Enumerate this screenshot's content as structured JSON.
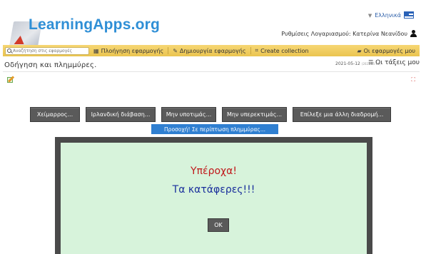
{
  "header": {
    "logo_text": "LearningApps.org",
    "language": "Ελληνικά",
    "account_text": "Ρυθμίσεις Λογαριασμού: Κατερίνα Νεανίδου"
  },
  "navbar": {
    "search_placeholder": "Αναζήτηση στις εφαρμογές",
    "items": [
      {
        "label": "Πλοήγηση εφαρμογής",
        "icon": "grid-icon"
      },
      {
        "label": "Δημιουργία εφαρμογής",
        "icon": "pencil-icon"
      },
      {
        "label": "Create collection",
        "icon": "collection-icon"
      }
    ],
    "my_apps_label": "Οι εφαρμογές μου"
  },
  "page": {
    "title": "Οδήγηση και πλημμύρες.",
    "date": "2021-05-12",
    "date_small": "(2021-05-11)",
    "classes_label": "Οι τάξεις μου"
  },
  "choices": [
    {
      "label": "Χείμαρρος..."
    },
    {
      "label": "Ιρλανδική διάβαση..."
    },
    {
      "label": "Μην υποτιμάς..."
    },
    {
      "label": "Μην υπερεκτιμάς..."
    },
    {
      "label": "Επίλεξε μια άλλη διαδρομή..."
    }
  ],
  "tip": "Προσοχή! Σε περίπτωση πλημμύρας...",
  "modal": {
    "title": "Υπέροχα!",
    "message": "Τα κατάφερες!!!",
    "ok_label": "OK"
  },
  "colors": {
    "navbar": "#eac44f",
    "choice_button": "#5a5a5a",
    "tip": "#2f7fd1",
    "modal_bg": "#d7f3db",
    "title_red": "#c0171a",
    "message_blue": "#1a2f9c",
    "logo_blue": "#2f8fd6"
  }
}
